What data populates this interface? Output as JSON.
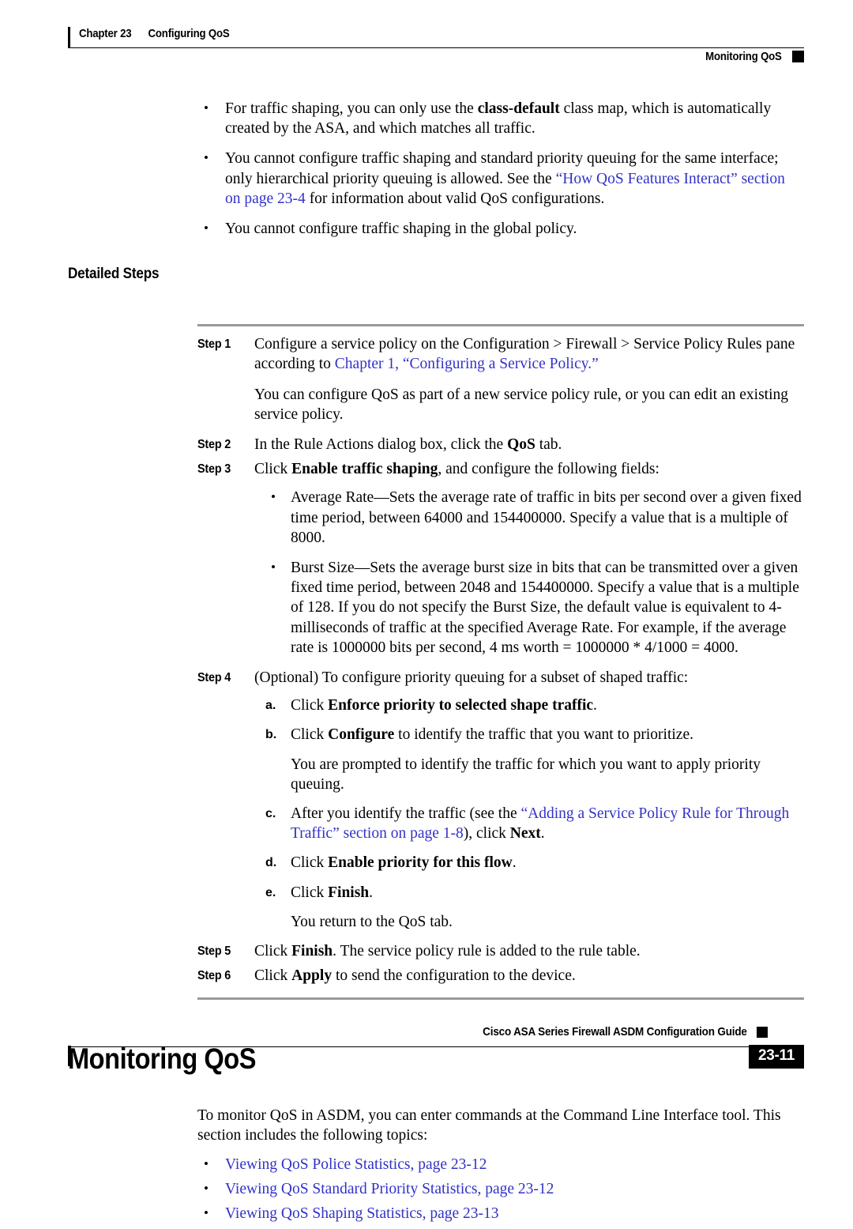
{
  "header": {
    "chapter_number": "Chapter 23",
    "chapter_title": "Configuring QoS",
    "section_title": "Monitoring QoS"
  },
  "intro_bullets": [
    {
      "parts": [
        {
          "t": "For traffic shaping, you can only use the ",
          "s": "normal"
        },
        {
          "t": "class-default",
          "s": "bold"
        },
        {
          "t": " class map, which is automatically created by the ASA, and which matches all traffic.",
          "s": "normal"
        }
      ]
    },
    {
      "parts": [
        {
          "t": "You cannot configure traffic shaping and standard priority queuing for the same interface; only hierarchical priority queuing is allowed. See the ",
          "s": "normal"
        },
        {
          "t": "“How QoS Features Interact” section on page 23-4",
          "s": "link"
        },
        {
          "t": " for information about valid QoS configurations.",
          "s": "normal"
        }
      ]
    },
    {
      "parts": [
        {
          "t": "You cannot configure traffic shaping in the global policy.",
          "s": "normal"
        }
      ]
    }
  ],
  "detailed_steps_heading": "Detailed Steps",
  "steps": {
    "step1": {
      "label": "Step 1",
      "parts": [
        {
          "t": "Configure a service policy on the Configuration > Firewall > Service Policy Rules pane according to ",
          "s": "normal"
        },
        {
          "t": "Chapter 1, “Configuring a Service Policy.”",
          "s": "link"
        }
      ],
      "continuation": "You can configure QoS as part of a new service policy rule, or you can edit an existing service policy."
    },
    "step2": {
      "label": "Step 2",
      "parts": [
        {
          "t": "In the Rule Actions dialog box, click the ",
          "s": "normal"
        },
        {
          "t": "QoS",
          "s": "bold"
        },
        {
          "t": " tab.",
          "s": "normal"
        }
      ]
    },
    "step3": {
      "label": "Step 3",
      "parts": [
        {
          "t": "Click ",
          "s": "normal"
        },
        {
          "t": "Enable traffic shaping",
          "s": "bold"
        },
        {
          "t": ", and configure the following fields:",
          "s": "normal"
        }
      ],
      "bullets": [
        {
          "parts": [
            {
              "t": "Average Rate—Sets the average rate of traffic in bits per second over a given fixed time period, between 64000 and 154400000. Specify a value that is a multiple of 8000.",
              "s": "normal"
            }
          ]
        },
        {
          "parts": [
            {
              "t": "Burst Size—Sets the average burst size in bits that can be transmitted over a given fixed time period, between 2048 and 154400000. Specify a value that is a multiple of 128. If you do not specify the Burst Size, the default value is equivalent to 4-milliseconds of traffic at the specified Average Rate. For example, if the average rate is 1000000 bits per second, 4 ms worth = 1000000 * 4/1000 = 4000.",
              "s": "normal"
            }
          ]
        }
      ]
    },
    "step4": {
      "label": "Step 4",
      "parts": [
        {
          "t": "(Optional) To configure priority queuing for a subset of shaped traffic:",
          "s": "normal"
        }
      ],
      "alpha_items": [
        {
          "marker": "a.",
          "parts": [
            {
              "t": "Click ",
              "s": "normal"
            },
            {
              "t": "Enforce priority to selected shape traffic",
              "s": "bold"
            },
            {
              "t": ".",
              "s": "normal"
            }
          ]
        },
        {
          "marker": "b.",
          "parts": [
            {
              "t": "Click ",
              "s": "normal"
            },
            {
              "t": "Configure",
              "s": "bold"
            },
            {
              "t": " to identify the traffic that you want to prioritize.",
              "s": "normal"
            }
          ],
          "continuation": "You are prompted to identify the traffic for which you want to apply priority queuing."
        },
        {
          "marker": "c.",
          "parts": [
            {
              "t": "After you identify the traffic (see the ",
              "s": "normal"
            },
            {
              "t": "“Adding a Service Policy Rule for Through Traffic” section on page 1-8",
              "s": "link"
            },
            {
              "t": "), click ",
              "s": "normal"
            },
            {
              "t": "Next",
              "s": "bold"
            },
            {
              "t": ".",
              "s": "normal"
            }
          ]
        },
        {
          "marker": "d.",
          "parts": [
            {
              "t": "Click ",
              "s": "normal"
            },
            {
              "t": "Enable priority for this flow",
              "s": "bold"
            },
            {
              "t": ".",
              "s": "normal"
            }
          ]
        },
        {
          "marker": "e.",
          "parts": [
            {
              "t": "Click ",
              "s": "normal"
            },
            {
              "t": "Finish",
              "s": "bold"
            },
            {
              "t": ".",
              "s": "normal"
            }
          ],
          "continuation": "You return to the QoS tab."
        }
      ]
    },
    "step5": {
      "label": "Step 5",
      "parts": [
        {
          "t": "Click ",
          "s": "normal"
        },
        {
          "t": "Finish",
          "s": "bold"
        },
        {
          "t": ". The service policy rule is added to the rule table.",
          "s": "normal"
        }
      ]
    },
    "step6": {
      "label": "Step 6",
      "parts": [
        {
          "t": "Click ",
          "s": "normal"
        },
        {
          "t": "Apply",
          "s": "bold"
        },
        {
          "t": " to send the configuration to the device.",
          "s": "normal"
        }
      ]
    }
  },
  "monitoring_section": {
    "heading": "Monitoring QoS",
    "intro": "To monitor QoS in ASDM, you can enter commands at the Command Line Interface tool. This section includes the following topics:",
    "topics": [
      "Viewing QoS Police Statistics, page 23-12",
      "Viewing QoS Standard Priority Statistics, page 23-12",
      "Viewing QoS Shaping Statistics, page 23-13"
    ]
  },
  "footer": {
    "guide_title": "Cisco ASA Series Firewall ASDM Configuration Guide",
    "page_number": "23-11"
  },
  "colors": {
    "link": "#3232c8",
    "rule_gray": "#9a9a9a",
    "text": "#000000"
  }
}
